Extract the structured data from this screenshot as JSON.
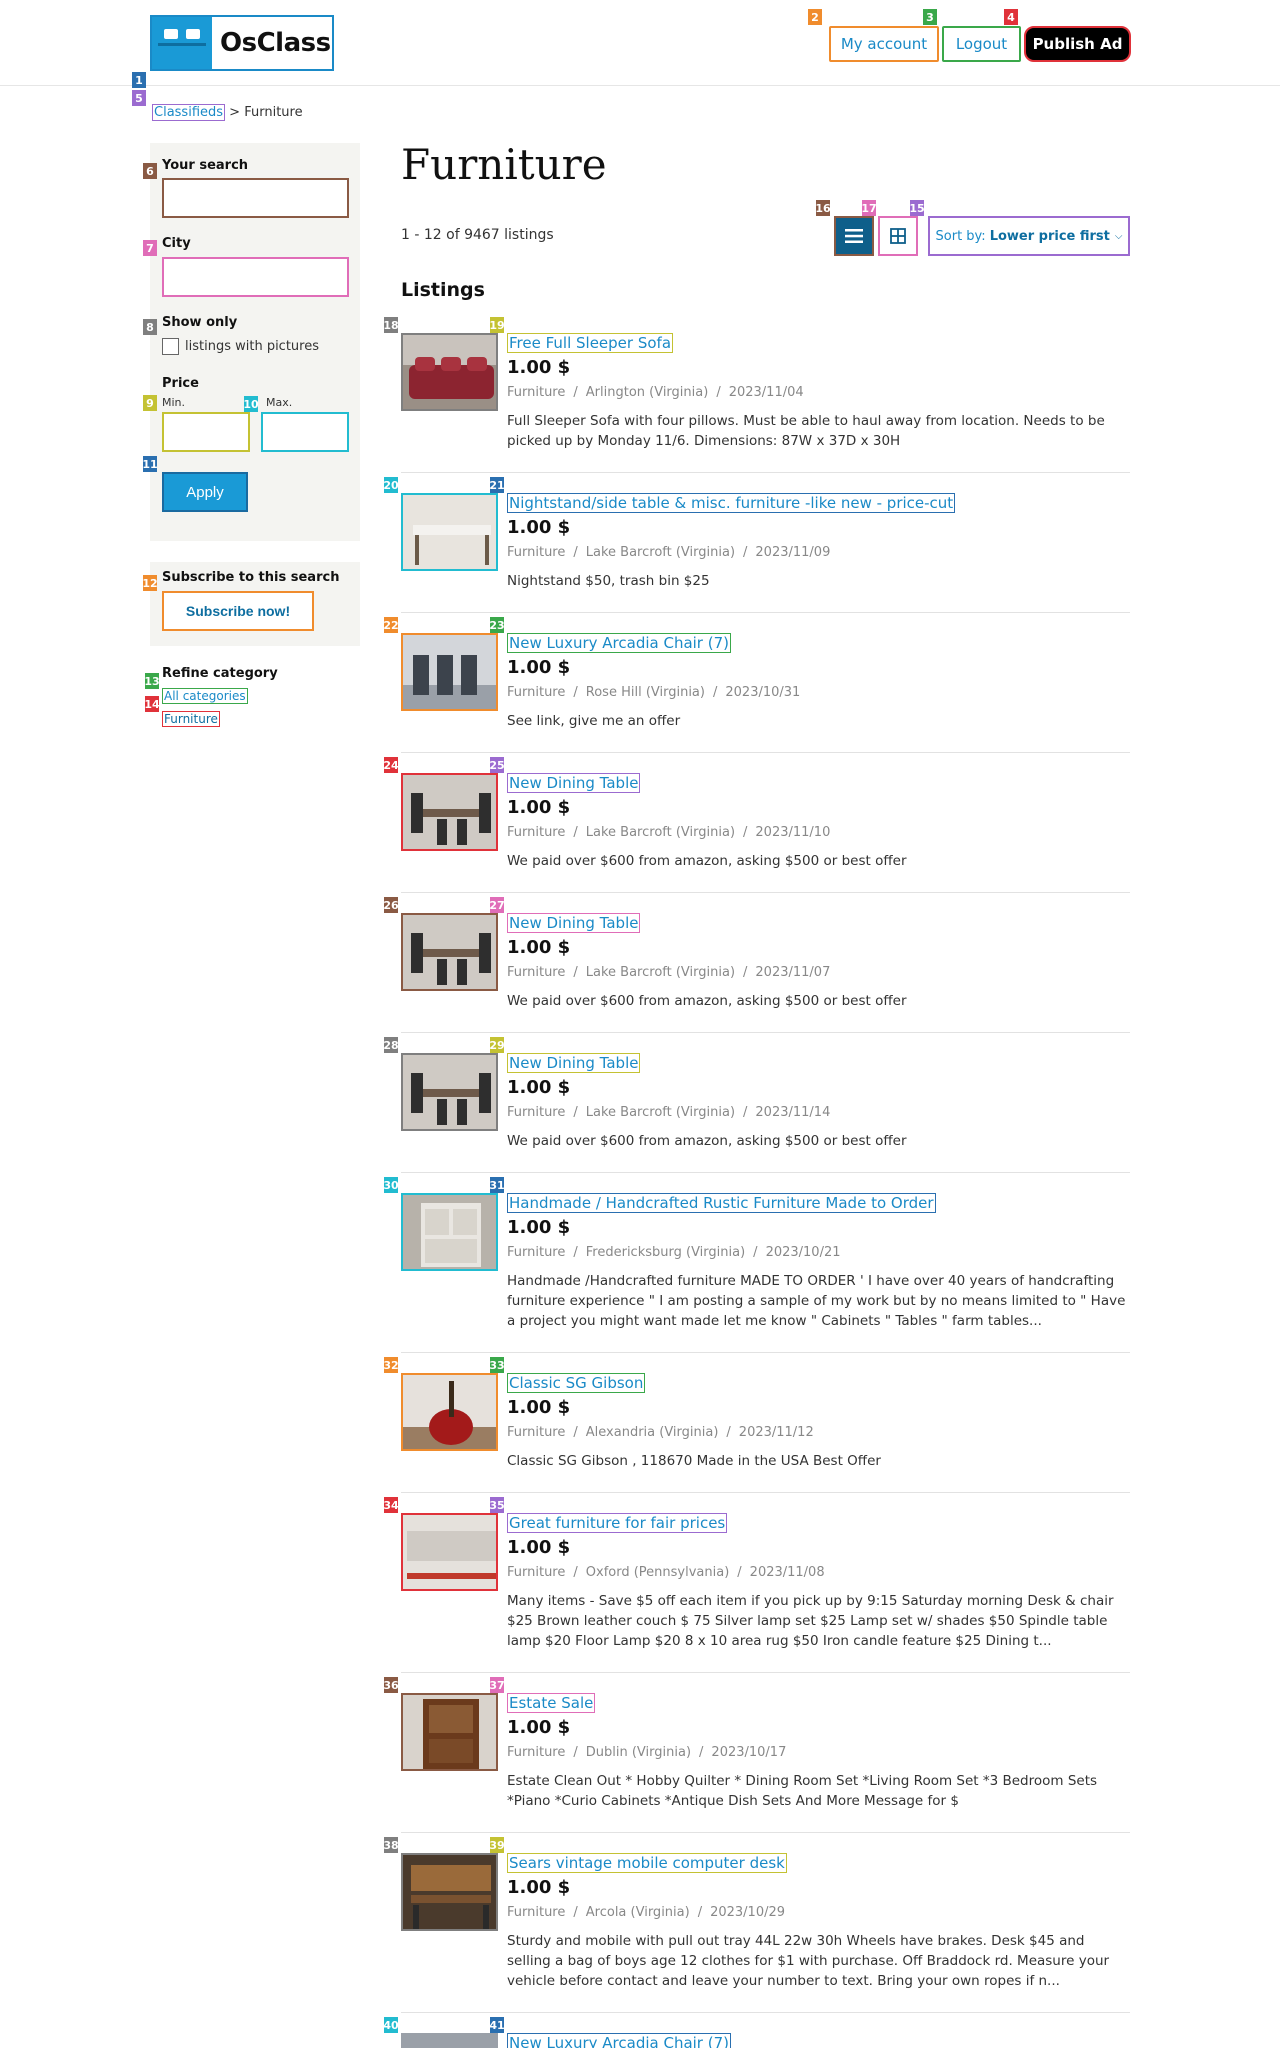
{
  "brand": {
    "logo_text": "OsClass"
  },
  "header": {
    "my_account": "My account",
    "logout": "Logout",
    "publish": "Publish Ad"
  },
  "breadcrumb": {
    "root": "Classifieds",
    "separator": ">",
    "current": "Furniture"
  },
  "sidebar": {
    "your_search_label": "Your search",
    "city_label": "City",
    "show_only_label": "Show only",
    "pictures_checkbox": "listings with pictures",
    "price_label": "Price",
    "min_label": "Min.",
    "max_label": "Max.",
    "apply": "Apply",
    "subscribe_label": "Subscribe to this search",
    "subscribe_button": "Subscribe now!",
    "refine_label": "Refine category",
    "all_categories": "All categories",
    "furniture": "Furniture"
  },
  "main": {
    "title": "Furniture",
    "count": "1 - 12 of 9467 listings",
    "sort_prefix": "Sort by:",
    "sort_value": "Lower price first",
    "listings_heading": "Listings"
  },
  "tags": [
    "1",
    "2",
    "3",
    "4",
    "5",
    "6",
    "7",
    "8",
    "9",
    "10",
    "11",
    "12",
    "13",
    "14",
    "15",
    "16",
    "17",
    "18",
    "19",
    "20",
    "21",
    "22",
    "23",
    "24",
    "25",
    "26",
    "27",
    "28",
    "29",
    "30",
    "31",
    "32",
    "33",
    "34",
    "35",
    "36",
    "37",
    "38",
    "39",
    "40",
    "41"
  ],
  "listings": [
    {
      "title": "Free Full Sleeper Sofa",
      "price": "1.00 $",
      "category": "Furniture",
      "location": "Arlington (Virginia)",
      "date": "2023/11/04",
      "desc": "Full Sleeper Sofa with four pillows. Must be able to haul away from location. Needs to be picked up by Monday 11/6. Dimensions: 87W x 37D x 30H"
    },
    {
      "title": "Nightstand/side table & misc. furniture -like new - price-cut",
      "price": "1.00 $",
      "category": "Furniture",
      "location": "Lake Barcroft (Virginia)",
      "date": "2023/11/09",
      "desc": "Nightstand $50, trash bin $25"
    },
    {
      "title": "New Luxury Arcadia Chair (7)",
      "price": "1.00 $",
      "category": "Furniture",
      "location": "Rose Hill (Virginia)",
      "date": "2023/10/31",
      "desc": "See link, give me an offer"
    },
    {
      "title": "New Dining Table",
      "price": "1.00 $",
      "category": "Furniture",
      "location": "Lake Barcroft (Virginia)",
      "date": "2023/11/10",
      "desc": "We paid over $600 from amazon, asking $500 or best offer"
    },
    {
      "title": "New Dining Table",
      "price": "1.00 $",
      "category": "Furniture",
      "location": "Lake Barcroft (Virginia)",
      "date": "2023/11/07",
      "desc": "We paid over $600 from amazon, asking $500 or best offer"
    },
    {
      "title": "New Dining Table",
      "price": "1.00 $",
      "category": "Furniture",
      "location": "Lake Barcroft (Virginia)",
      "date": "2023/11/14",
      "desc": "We paid over $600 from amazon, asking $500 or best offer"
    },
    {
      "title": "Handmade / Handcrafted Rustic Furniture Made to Order",
      "price": "1.00 $",
      "category": "Furniture",
      "location": "Fredericksburg (Virginia)",
      "date": "2023/10/21",
      "desc": "Handmade /Handcrafted furniture MADE TO ORDER ' I have over 40 years of handcrafting furniture experience \" I am posting a sample of my work but by no means limited to \" Have a project you might want made let me know \" Cabinets \" Tables \" farm tables..."
    },
    {
      "title": "Classic SG Gibson",
      "price": "1.00 $",
      "category": "Furniture",
      "location": "Alexandria (Virginia)",
      "date": "2023/11/12",
      "desc": "Classic SG Gibson , 118670 Made in the USA Best Offer"
    },
    {
      "title": "Great furniture for fair prices",
      "price": "1.00 $",
      "category": "Furniture",
      "location": "Oxford (Pennsylvania)",
      "date": "2023/11/08",
      "desc": "Many items - Save $5 off each item if you pick up by 9:15 Saturday morning Desk & chair $25 Brown leather couch $ 75 Silver lamp set $25 Lamp set w/ shades $50 Spindle table lamp $20 Floor Lamp $20 8 x 10 area rug $50 Iron candle feature $25 Dining t..."
    },
    {
      "title": "Estate Sale",
      "price": "1.00 $",
      "category": "Furniture",
      "location": "Dublin (Virginia)",
      "date": "2023/10/17",
      "desc": "Estate Clean Out * Hobby Quilter * Dining Room Set *Living Room Set *3 Bedroom Sets *Piano *Curio Cabinets *Antique Dish Sets And More Message for $"
    },
    {
      "title": "Sears vintage mobile computer desk",
      "price": "1.00 $",
      "category": "Furniture",
      "location": "Arcola (Virginia)",
      "date": "2023/10/29",
      "desc": "Sturdy and mobile with pull out tray 44L 22w 30h Wheels have brakes. Desk $45 and selling a bag of boys age 12 clothes for $1 with purchase. Off Braddock rd. Measure your vehicle before contact and leave your number to text. Bring your own ropes if n..."
    },
    {
      "title": "New Luxury Arcadia Chair (7)",
      "price": "",
      "category": "",
      "location": "",
      "date": "",
      "desc": ""
    }
  ],
  "colors": {
    "accent": "#1a8ac7",
    "publish_bg": "#000000",
    "apply_bg": "#1a9ad6",
    "list_view_bg": "#0e5f8a",
    "sidebar_bg": "#f4f4f1"
  }
}
